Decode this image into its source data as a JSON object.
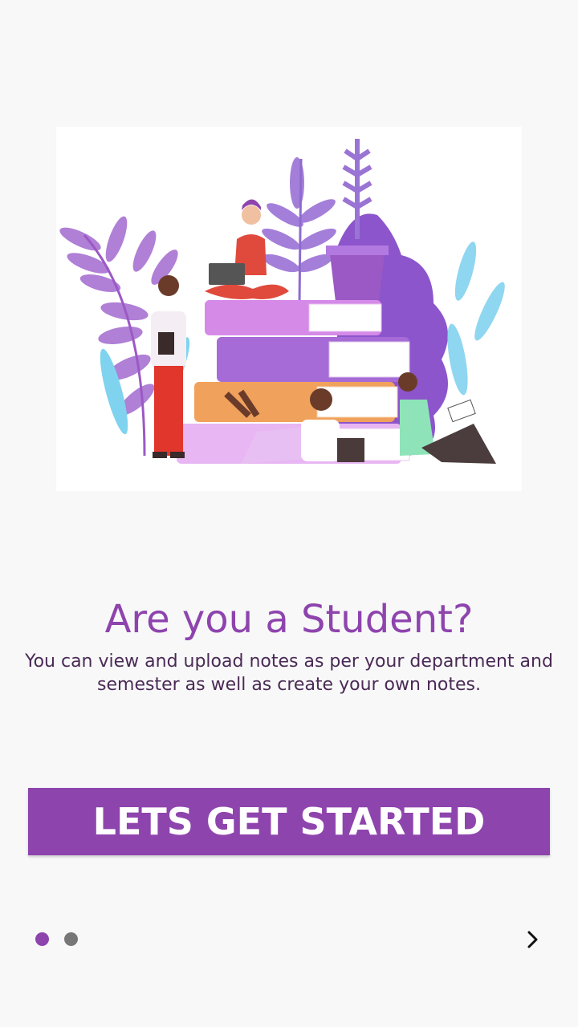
{
  "onboarding": {
    "title": "Are you a Student?",
    "description": "You can view and upload notes as per your department and semester as well as create your own notes.",
    "cta_label": "LETS GET STARTED",
    "illustration": "students-with-books-illustration"
  },
  "pager": {
    "total_pages": 2,
    "current_page": 1,
    "active_color": "#8e44ad",
    "inactive_color": "#777777",
    "next_icon": "chevron-right-icon"
  },
  "theme": {
    "accent": "#8e44ad",
    "background": "#f8f8f9"
  }
}
